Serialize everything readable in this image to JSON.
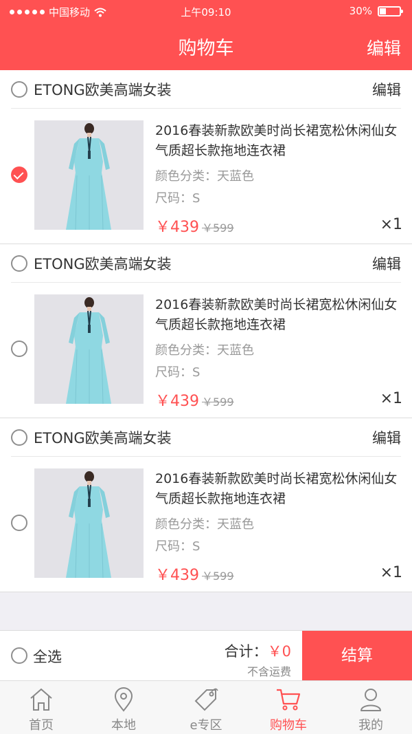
{
  "status": {
    "carrier": "中国移动",
    "time": "上午09:10",
    "battery": "30%",
    "battery_level": 0.3
  },
  "nav": {
    "title": "购物车",
    "edit": "编辑"
  },
  "shops": [
    {
      "name": "ETONG欧美高端女装",
      "edit": "编辑",
      "checked": false,
      "item": {
        "title": "2016春装新款欧美时尚长裙宽松休闲仙女气质超长款拖地连衣裙",
        "color": "颜色分类：天蓝色",
        "size": "尺码：S",
        "price": "￥439",
        "orig": "￥599",
        "qty": "×1",
        "checked": true
      }
    },
    {
      "name": "ETONG欧美高端女装",
      "edit": "编辑",
      "checked": false,
      "item": {
        "title": "2016春装新款欧美时尚长裙宽松休闲仙女气质超长款拖地连衣裙",
        "color": "颜色分类：天蓝色",
        "size": "尺码：S",
        "price": "￥439",
        "orig": "￥599",
        "qty": "×1",
        "checked": false
      }
    },
    {
      "name": "ETONG欧美高端女装",
      "edit": "编辑",
      "checked": false,
      "item": {
        "title": "2016春装新款欧美时尚长裙宽松休闲仙女气质超长款拖地连衣裙",
        "color": "颜色分类：天蓝色",
        "size": "尺码：S",
        "price": "￥439",
        "orig": "￥599",
        "qty": "×1",
        "checked": false
      }
    }
  ],
  "footer": {
    "select_all": "全选",
    "total_label": "合计：",
    "total_amount": "￥0",
    "shipping": "不含运费",
    "checkout": "结算"
  },
  "tabs": [
    {
      "label": "首页",
      "icon": "home-icon",
      "active": false
    },
    {
      "label": "本地",
      "icon": "location-icon",
      "active": false
    },
    {
      "label": "e专区",
      "icon": "tag-icon",
      "active": false
    },
    {
      "label": "购物车",
      "icon": "cart-icon",
      "active": true
    },
    {
      "label": "我的",
      "icon": "user-icon",
      "active": false
    }
  ],
  "colors": {
    "accent": "#ff5152",
    "background": "#f0eff4",
    "muted": "#999999"
  }
}
